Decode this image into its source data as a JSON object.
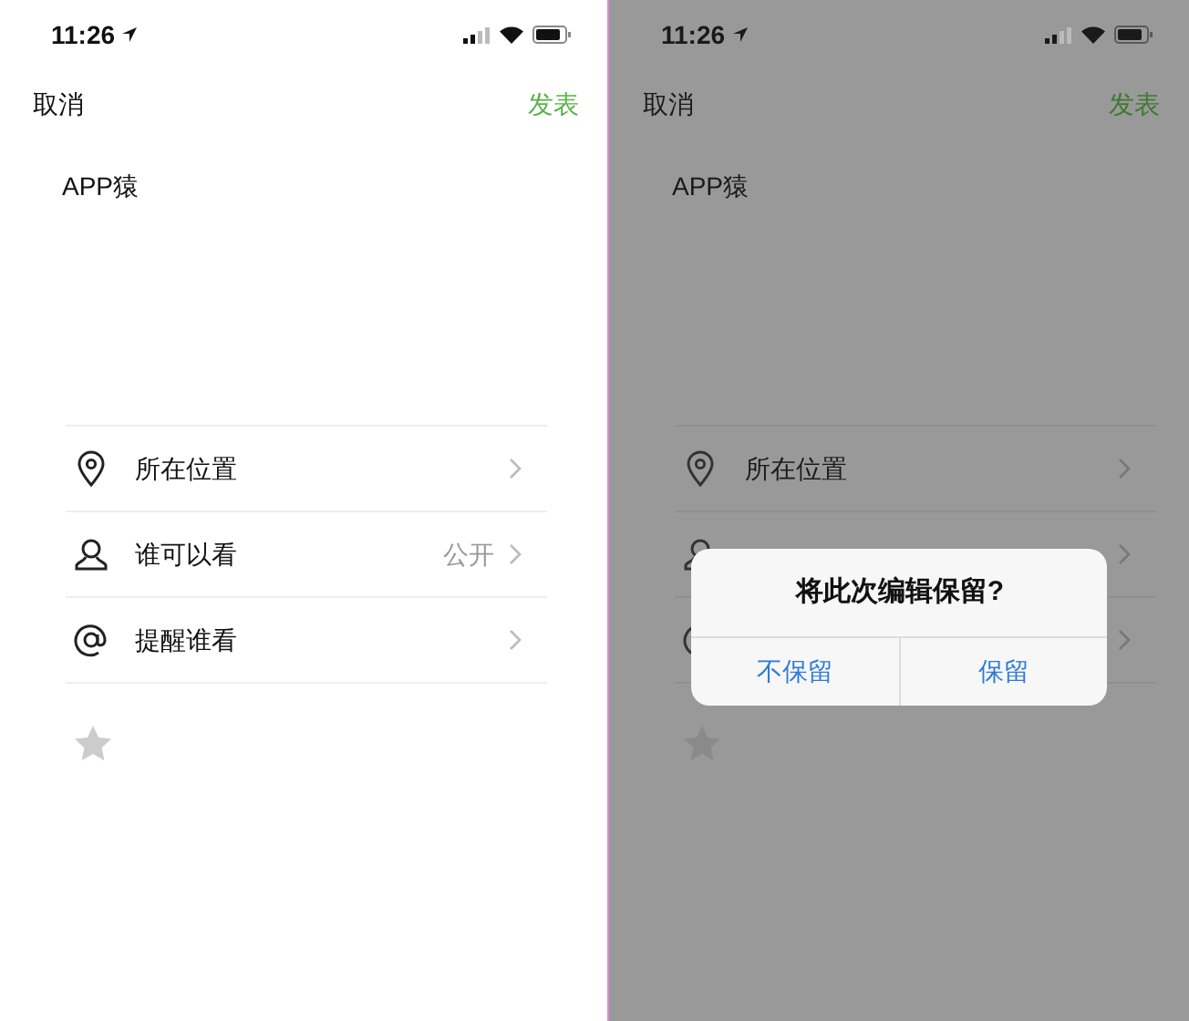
{
  "screens": [
    {
      "dimmed": false,
      "status_bar": {
        "time": "11:26"
      },
      "nav": {
        "cancel": "取消",
        "publish": "发表"
      },
      "content": "APP猿",
      "rows": [
        {
          "kind": "location",
          "label": "所在位置"
        },
        {
          "kind": "visibility",
          "label": "谁可以看",
          "value": "公开"
        },
        {
          "kind": "mention",
          "label": "提醒谁看"
        }
      ]
    },
    {
      "dimmed": true,
      "status_bar": {
        "time": "11:26"
      },
      "nav": {
        "cancel": "取消",
        "publish": "发表"
      },
      "content": "APP猿",
      "rows": [
        {
          "kind": "location",
          "label": "所在位置"
        },
        {
          "kind": "visibility"
        },
        {
          "kind": "mention"
        }
      ],
      "dialog": {
        "title": "将此次编辑保留?",
        "buttons": [
          "不保留",
          "保留"
        ]
      }
    }
  ]
}
